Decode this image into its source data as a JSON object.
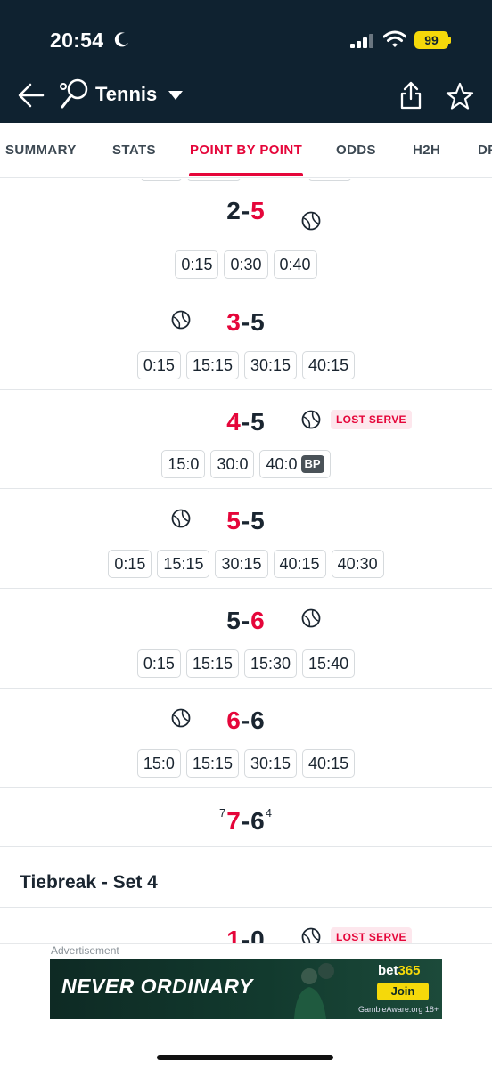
{
  "status_bar": {
    "time": "20:54",
    "battery": "99"
  },
  "app_header": {
    "title": "Tennis"
  },
  "tabs": [
    {
      "label": "SUMMARY"
    },
    {
      "label": "STATS"
    },
    {
      "label": "POINT BY POINT"
    },
    {
      "label": "ODDS"
    },
    {
      "label": "H2H"
    },
    {
      "label": "DF"
    }
  ],
  "active_tab": "POINT BY POINT",
  "games": [
    {
      "score_left": "2",
      "score_right": "5",
      "highlight": "right",
      "server": "right",
      "lost_serve": false,
      "points": [
        "0:15",
        "0:30",
        "0:40"
      ]
    },
    {
      "score_left": "3",
      "score_right": "5",
      "highlight": "left",
      "server": "left",
      "lost_serve": false,
      "points": [
        "0:15",
        "15:15",
        "30:15",
        "40:15"
      ]
    },
    {
      "score_left": "4",
      "score_right": "5",
      "highlight": "left",
      "server": "right",
      "lost_serve": true,
      "points": [
        "15:0",
        "30:0",
        "40:0"
      ],
      "break_point_on": "40:0"
    },
    {
      "score_left": "5",
      "score_right": "5",
      "highlight": "left",
      "server": "left",
      "lost_serve": false,
      "points": [
        "0:15",
        "15:15",
        "30:15",
        "40:15",
        "40:30"
      ]
    },
    {
      "score_left": "5",
      "score_right": "6",
      "highlight": "right",
      "server": "right",
      "lost_serve": false,
      "points": [
        "0:15",
        "15:15",
        "15:30",
        "15:40"
      ]
    },
    {
      "score_left": "6",
      "score_right": "6",
      "highlight": "left",
      "server": "left",
      "lost_serve": false,
      "points": [
        "15:0",
        "15:15",
        "30:15",
        "40:15"
      ]
    }
  ],
  "set_result": {
    "tb_left": "7",
    "left": "7",
    "dash": "-",
    "right": "6",
    "tb_right": "4"
  },
  "tiebreak": {
    "title": "Tiebreak - Set 4",
    "first_score_left": "1",
    "first_score_right": "0"
  },
  "labels": {
    "lost_serve": "LOST SERVE",
    "break_point": "BP",
    "dash": "-"
  },
  "ad": {
    "label": "Advertisement",
    "headline": "NEVER ORDINARY",
    "brand_main": "bet",
    "brand_accent": "365",
    "cta": "Join",
    "footer": "GambleAware.org 18+"
  },
  "colors": {
    "header_bg": "#0f2230",
    "accent": "#e5063a",
    "lost_serve_bg": "#fde7ed"
  }
}
